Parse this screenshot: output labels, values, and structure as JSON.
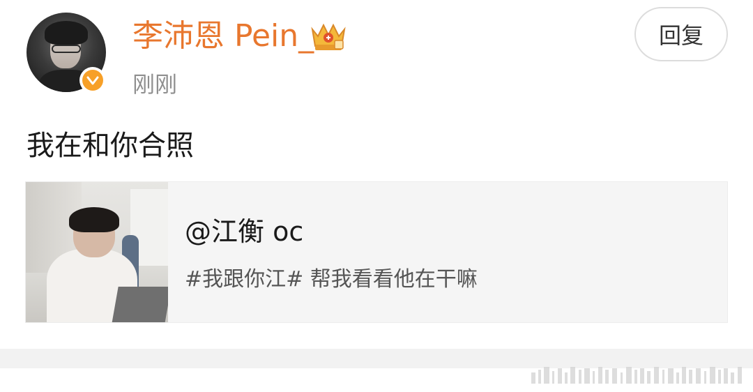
{
  "author": {
    "name": "李沛恩 Pein_",
    "timestamp": "刚刚",
    "name_color": "#e8772e",
    "verified_color": "#f7a028"
  },
  "actions": {
    "reply_label": "回复"
  },
  "post": {
    "text": "我在和你合照"
  },
  "quote": {
    "mention": "@江衡 oc",
    "body": "#我跟你江# 帮我看看他在干嘛"
  },
  "icons": {
    "avatar": "avatar-photo",
    "verified": "verified-badge-icon",
    "crown": "crown-icon",
    "thumbnail": "photo-thumbnail"
  }
}
